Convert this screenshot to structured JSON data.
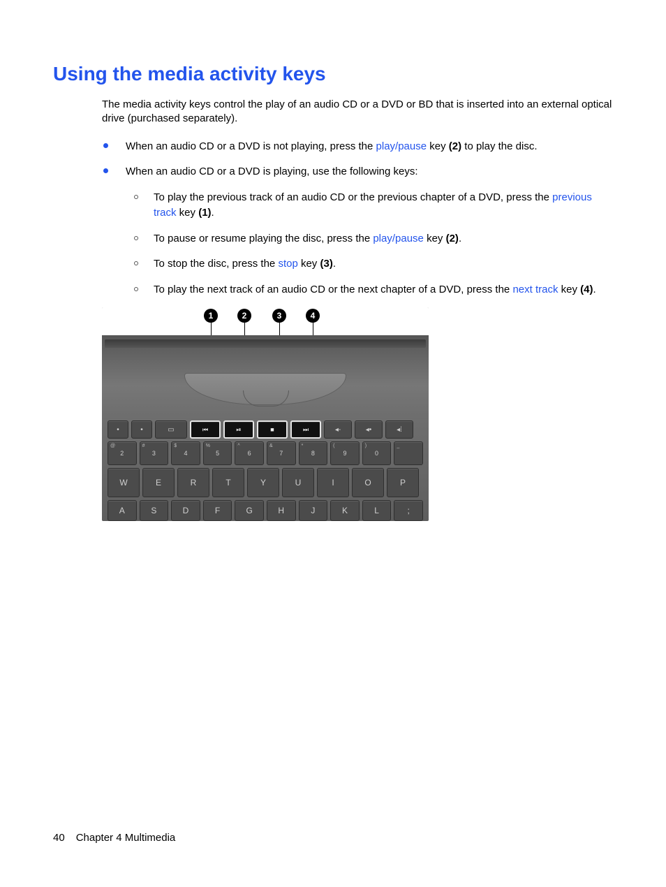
{
  "title": "Using the media activity keys",
  "intro": "The media activity keys control the play of an audio CD or a DVD or BD that is inserted into an external optical drive (purchased separately).",
  "b1": {
    "pre": "When an audio CD or a DVD is not playing, press the ",
    "link": "play/pause",
    "post1": " key ",
    "ref": "(2)",
    "post2": " to play the disc."
  },
  "b2_intro": "When an audio CD or a DVD is playing, use the following keys:",
  "s1": {
    "pre": "To play the previous track of an audio CD or the previous chapter of a DVD, press the ",
    "link": "previous track",
    "post1": " key ",
    "ref": "(1)",
    "post2": "."
  },
  "s2": {
    "pre": "To pause or resume playing the disc, press the ",
    "link": "play/pause",
    "post1": " key ",
    "ref": "(2)",
    "post2": "."
  },
  "s3": {
    "pre": "To stop the disc, press the ",
    "link": "stop",
    "post1": " key ",
    "ref": "(3)",
    "post2": "."
  },
  "s4": {
    "pre": "To play the next track of an audio CD or the next chapter of a DVD, press the ",
    "link": "next track",
    "post1": " key ",
    "ref": "(4)",
    "post2": "."
  },
  "callouts": {
    "1": "1",
    "2": "2",
    "3": "3",
    "4": "4"
  },
  "keys": {
    "numrow": [
      "2",
      "3",
      "4",
      "5",
      "6",
      "7",
      "8",
      "9",
      "0"
    ],
    "numsup": [
      "@",
      "#",
      "$",
      "%",
      "^",
      "&",
      "*",
      "(",
      ")",
      "_"
    ],
    "letters1": [
      "W",
      "E",
      "R",
      "T",
      "Y",
      "U",
      "I",
      "O",
      "P"
    ],
    "letters2": [
      "A",
      "S",
      "D",
      "F",
      "G",
      "H",
      "J",
      "K",
      "L",
      ";"
    ]
  },
  "footer": {
    "page": "40",
    "chapter": "Chapter 4   Multimedia"
  }
}
